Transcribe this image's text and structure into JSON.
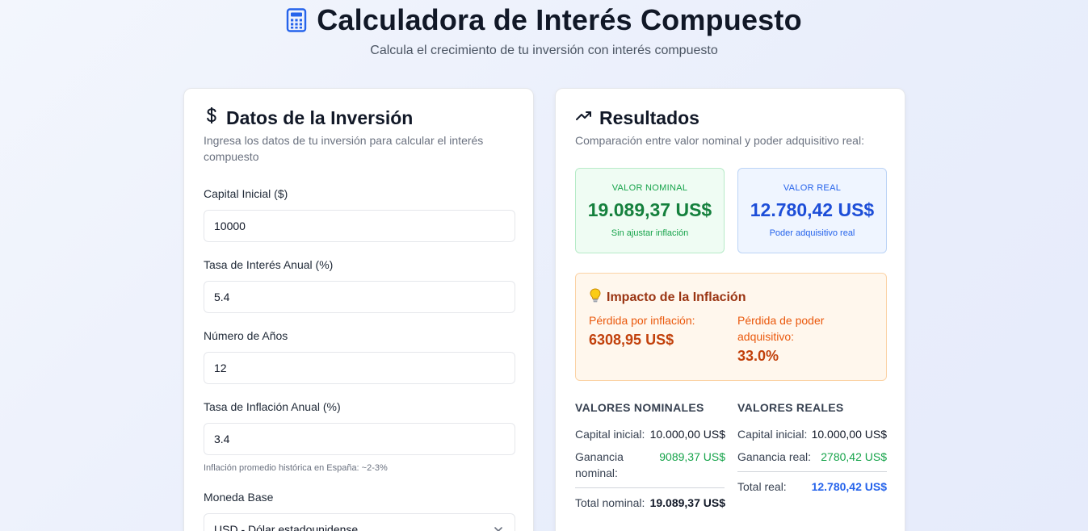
{
  "header": {
    "title": "Calculadora de Interés Compuesto",
    "subtitle": "Calcula el crecimiento de tu inversión con interés compuesto",
    "icon": "calculator-icon"
  },
  "form": {
    "title": "Datos de la Inversión",
    "icon": "dollar-icon",
    "description": "Ingresa los datos de tu inversión para calcular el interés compuesto",
    "capital_label": "Capital Inicial ($)",
    "capital_value": "10000",
    "rate_label": "Tasa de Interés Anual (%)",
    "rate_value": "5.4",
    "years_label": "Número de Años",
    "years_value": "12",
    "inflation_label": "Tasa de Inflación Anual (%)",
    "inflation_value": "3.4",
    "inflation_hint": "Inflación promedio histórica en España: ~2-3%",
    "currency_label": "Moneda Base",
    "currency_value": "USD - Dólar estadounidense"
  },
  "results": {
    "title": "Resultados",
    "icon": "trending-up-icon",
    "description": "Comparación entre valor nominal y poder adquisitivo real:",
    "nominal": {
      "heading": "VALOR NOMINAL",
      "value": "19.089,37 US$",
      "footnote": "Sin ajustar inflación"
    },
    "real": {
      "heading": "VALOR REAL",
      "value": "12.780,42 US$",
      "footnote": "Poder adquisitivo real"
    },
    "impact": {
      "title": "Impacto de la Inflación",
      "icon": "lightbulb-icon",
      "loss_label": "Pérdida por inflación:",
      "loss_value": "6308,95 US$",
      "power_label": "Pérdida de poder adquisitivo:",
      "power_value": "33.0%"
    },
    "nominal_values": {
      "heading": "VALORES NOMINALES",
      "capital_label": "Capital inicial:",
      "capital_value": "10.000,00 US$",
      "gain_label": "Ganancia nominal:",
      "gain_value": "9089,37 US$",
      "total_label": "Total nominal:",
      "total_value": "19.089,37 US$"
    },
    "real_values": {
      "heading": "VALORES REALES",
      "capital_label": "Capital inicial:",
      "capital_value": "10.000,00 US$",
      "gain_label": "Ganancia real:",
      "gain_value": "2780,42 US$",
      "total_label": "Total real:",
      "total_value": "12.780,42 US$"
    }
  },
  "colors": {
    "nominal_green": "#15803d",
    "real_blue": "#1d4ed8",
    "impact_orange": "#c2410c"
  }
}
